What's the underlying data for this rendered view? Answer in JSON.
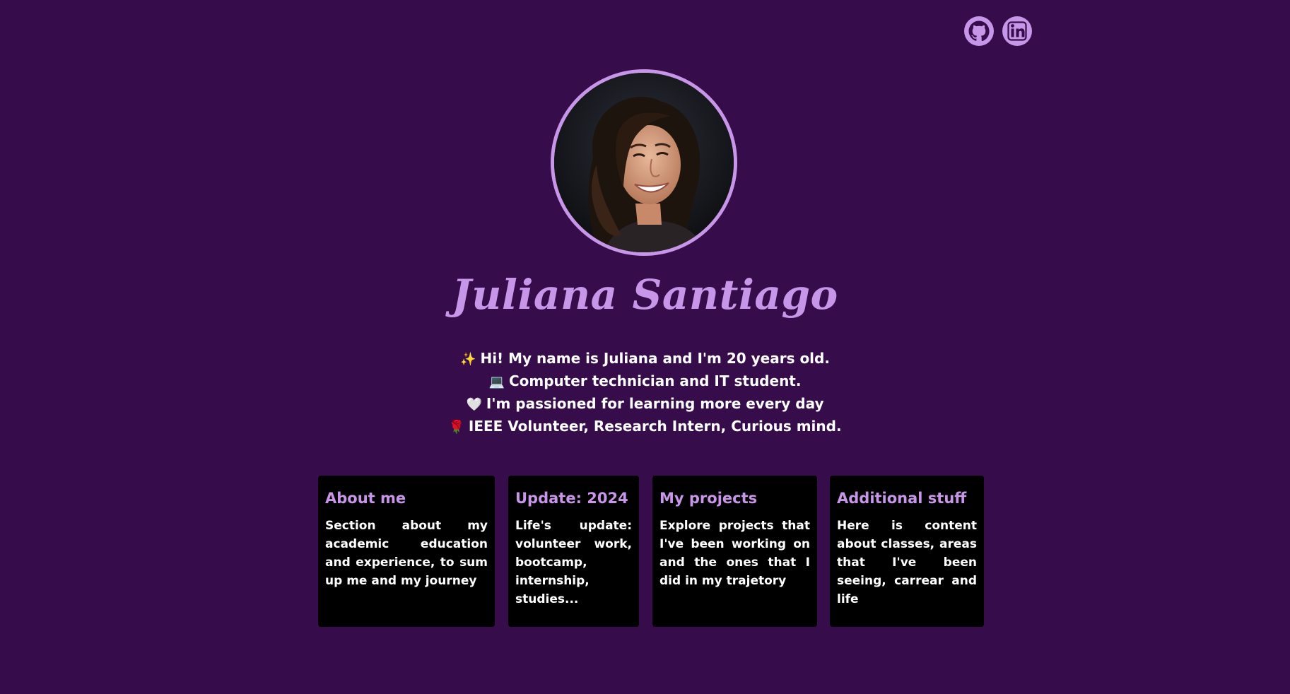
{
  "socials": {
    "github_icon": "github-icon",
    "linkedin_icon": "linkedin-icon"
  },
  "profile": {
    "name": "Juliana Santiago",
    "intro": [
      {
        "emoji": "✨",
        "text": "Hi! My name is Juliana and I'm 20 years old."
      },
      {
        "emoji": "💻",
        "text": "Computer technician and IT student."
      },
      {
        "emoji": "🤍",
        "text": "I'm passioned for learning more every day"
      },
      {
        "emoji": "🌹",
        "text": "IEEE Volunteer, Research Intern, Curious mind."
      }
    ]
  },
  "cards": [
    {
      "title": "About me",
      "description": "Section about my academic education and experience, to sum up me and my journey"
    },
    {
      "title": "Update: 2024",
      "description": "Life's update: volunteer work, bootcamp, internship, studies..."
    },
    {
      "title": "My projects",
      "description": "Explore projects that I've been working on and the ones that I did in my trajetory"
    },
    {
      "title": "Additional stuff",
      "description": "Here is content about classes, areas that I've been seeing, carrear and life"
    }
  ],
  "colors": {
    "background": "#360d4a",
    "accent": "#c896e8",
    "card": "#000000",
    "text": "#ffffff"
  }
}
